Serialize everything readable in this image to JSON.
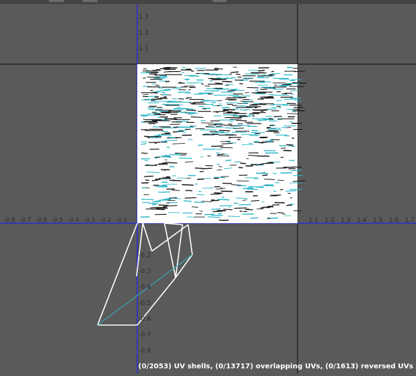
{
  "editor": {
    "status_hint": "(0/2053) UV shells, (0/13717) overlapping UVs, (0/1613) reversed UVs"
  },
  "axes": {
    "u_axis_ticks": [
      "-0.9",
      "-0.8",
      "-0.7",
      "-0.6",
      "-0.5",
      "-0.4",
      "-0.3",
      "-0.2",
      "-0.1",
      "1.1",
      "1.2",
      "1.3",
      "1.4",
      "1.5",
      "1.6",
      "1.7"
    ],
    "v_axis_ticks_top": [
      "1.3",
      "1.2",
      "1.1"
    ],
    "v_axis_ticks_bottom": [
      "-0.2",
      "-0.3",
      "-0.4",
      "-0.5",
      "-0.6",
      "-0.7",
      "-0.8",
      "-0.9"
    ]
  },
  "colors": {
    "background": "#5a5a5a",
    "grid_line": "#262626",
    "axis_line": "#2a2ad8",
    "wireframe": "#ffffff",
    "uv_edge_accent": "#2fb8c9"
  },
  "icons": {
    "toolbar_buttons": [
      "toolbar-button-icon",
      "toolbar-button-icon",
      "toolbar-button-icon"
    ]
  }
}
